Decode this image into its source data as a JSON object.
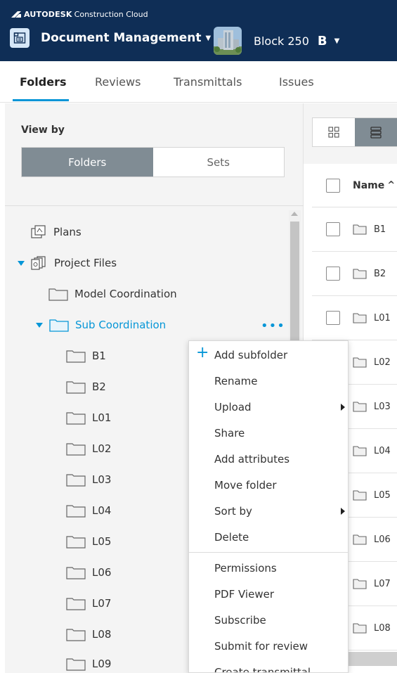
{
  "app": {
    "brand": "AUTODESK",
    "brand_suffix": "Construction Cloud",
    "module": "Document Management",
    "project": "Block 250",
    "project_badge": "B"
  },
  "tabs": [
    {
      "label": "Folders",
      "active": true
    },
    {
      "label": "Reviews",
      "active": false
    },
    {
      "label": "Transmittals",
      "active": false
    },
    {
      "label": "Issues",
      "active": false
    }
  ],
  "left_panel": {
    "view_by_label": "View by",
    "segments": [
      {
        "label": "Folders",
        "active": true
      },
      {
        "label": "Sets",
        "active": false
      }
    ],
    "tree": [
      {
        "label": "Plans",
        "icon": "plans-icon"
      },
      {
        "label": "Project Files",
        "icon": "project-files-icon",
        "expanded": true
      },
      {
        "label": "Model Coordination",
        "icon": "folder-icon"
      },
      {
        "label": "Sub Coordination",
        "icon": "folder-icon",
        "expanded": true,
        "selected": true
      },
      {
        "label": "B1",
        "icon": "folder-icon"
      },
      {
        "label": "B2",
        "icon": "folder-icon"
      },
      {
        "label": "L01",
        "icon": "folder-icon"
      },
      {
        "label": "L02",
        "icon": "folder-icon"
      },
      {
        "label": "L03",
        "icon": "folder-icon"
      },
      {
        "label": "L04",
        "icon": "folder-icon"
      },
      {
        "label": "L05",
        "icon": "folder-icon"
      },
      {
        "label": "L06",
        "icon": "folder-icon"
      },
      {
        "label": "L07",
        "icon": "folder-icon"
      },
      {
        "label": "L08",
        "icon": "folder-icon"
      },
      {
        "label": "L09",
        "icon": "folder-icon"
      }
    ],
    "more_label": "•••"
  },
  "right_panel": {
    "column_name": "Name",
    "sort_indicator": "^",
    "rows": [
      "B1",
      "B2",
      "L01",
      "L02",
      "L03",
      "L04",
      "L05",
      "L06",
      "L07",
      "L08"
    ]
  },
  "context_menu": {
    "items": [
      {
        "label": "Add subfolder",
        "plus": true
      },
      {
        "label": "Rename"
      },
      {
        "label": "Upload",
        "submenu": true
      },
      {
        "label": "Share"
      },
      {
        "label": "Add attributes"
      },
      {
        "label": "Move folder"
      },
      {
        "label": "Sort by",
        "submenu": true
      },
      {
        "label": "Delete"
      },
      {
        "label": "Permissions"
      },
      {
        "label": "PDF Viewer"
      },
      {
        "label": "Subscribe"
      },
      {
        "label": "Submit for review"
      },
      {
        "label": "Create transmittal"
      }
    ],
    "plus_glyph": "+"
  },
  "colors": {
    "header_bg": "#0f2e56",
    "accent": "#0696d7",
    "active_segment": "#808c94",
    "panel_bg": "#f4f4f4"
  }
}
